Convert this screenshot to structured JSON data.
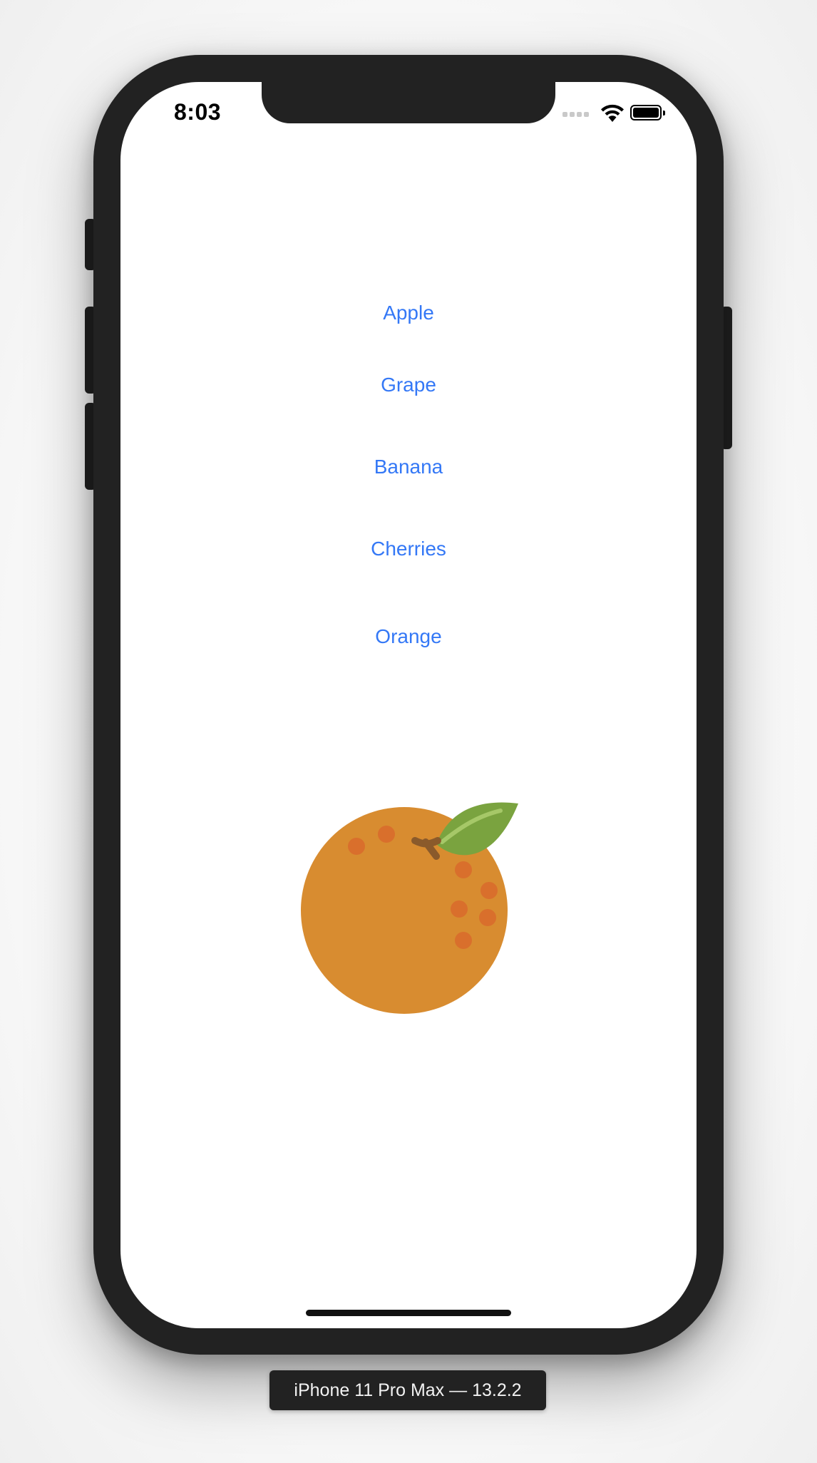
{
  "status_bar": {
    "time": "8:03",
    "icons": [
      "cellular-signal-icon",
      "wifi-icon",
      "battery-icon"
    ]
  },
  "fruits": [
    {
      "label": "Apple"
    },
    {
      "label": "Grape"
    },
    {
      "label": "Banana"
    },
    {
      "label": "Cherries"
    },
    {
      "label": "Orange"
    }
  ],
  "selected_fruit_image": "orange-illustration",
  "simulator_label": "iPhone 11 Pro Max — 13.2.2",
  "colors": {
    "link": "#3478f6",
    "device_frame": "#222222",
    "orange_body": "#d88c30",
    "orange_spots": "#d96f2c",
    "leaf": "#7aa33f",
    "stem": "#8a5a2b"
  }
}
